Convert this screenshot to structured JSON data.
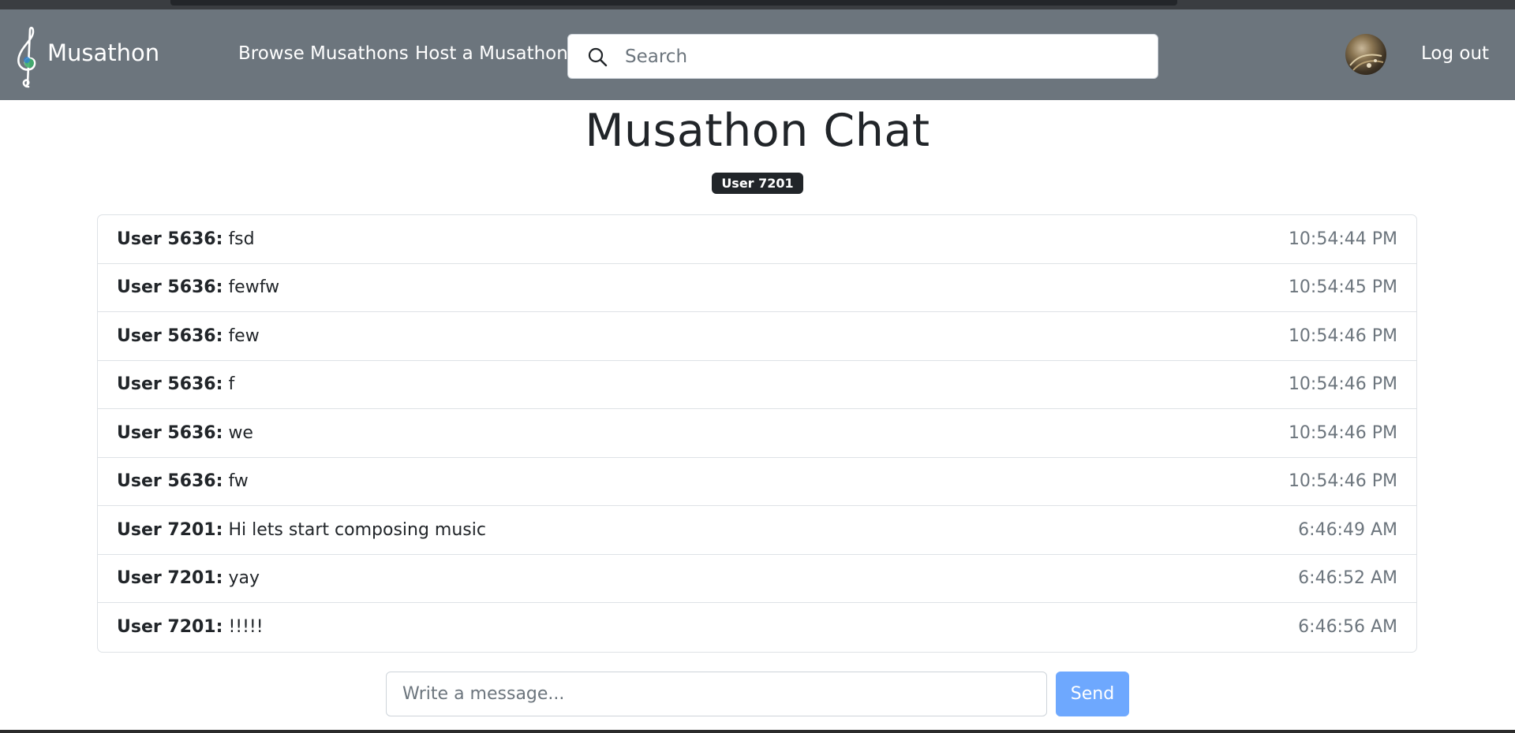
{
  "navbar": {
    "brand": "Musathon",
    "links": [
      "Browse Musathons",
      "Host a Musathon"
    ],
    "search_placeholder": "Search",
    "logout": "Log out"
  },
  "page": {
    "title": "Musathon Chat",
    "current_user": "User 7201"
  },
  "messages": [
    {
      "user": "User 5636",
      "text": "fsd",
      "time": "10:54:44 PM"
    },
    {
      "user": "User 5636",
      "text": "fewfw",
      "time": "10:54:45 PM"
    },
    {
      "user": "User 5636",
      "text": "few",
      "time": "10:54:46 PM"
    },
    {
      "user": "User 5636",
      "text": "f",
      "time": "10:54:46 PM"
    },
    {
      "user": "User 5636",
      "text": "we",
      "time": "10:54:46 PM"
    },
    {
      "user": "User 5636",
      "text": "fw",
      "time": "10:54:46 PM"
    },
    {
      "user": "User 7201",
      "text": "Hi lets start composing music",
      "time": "6:46:49 AM"
    },
    {
      "user": "User 7201",
      "text": "yay",
      "time": "6:46:52 AM"
    },
    {
      "user": "User 7201",
      "text": "!!!!!",
      "time": "6:46:56 AM"
    }
  ],
  "composer": {
    "placeholder": "Write a message...",
    "send_label": "Send"
  },
  "colors": {
    "navbar": "#6c757d",
    "send_button": "#6ea8fe",
    "badge": "#212529"
  }
}
